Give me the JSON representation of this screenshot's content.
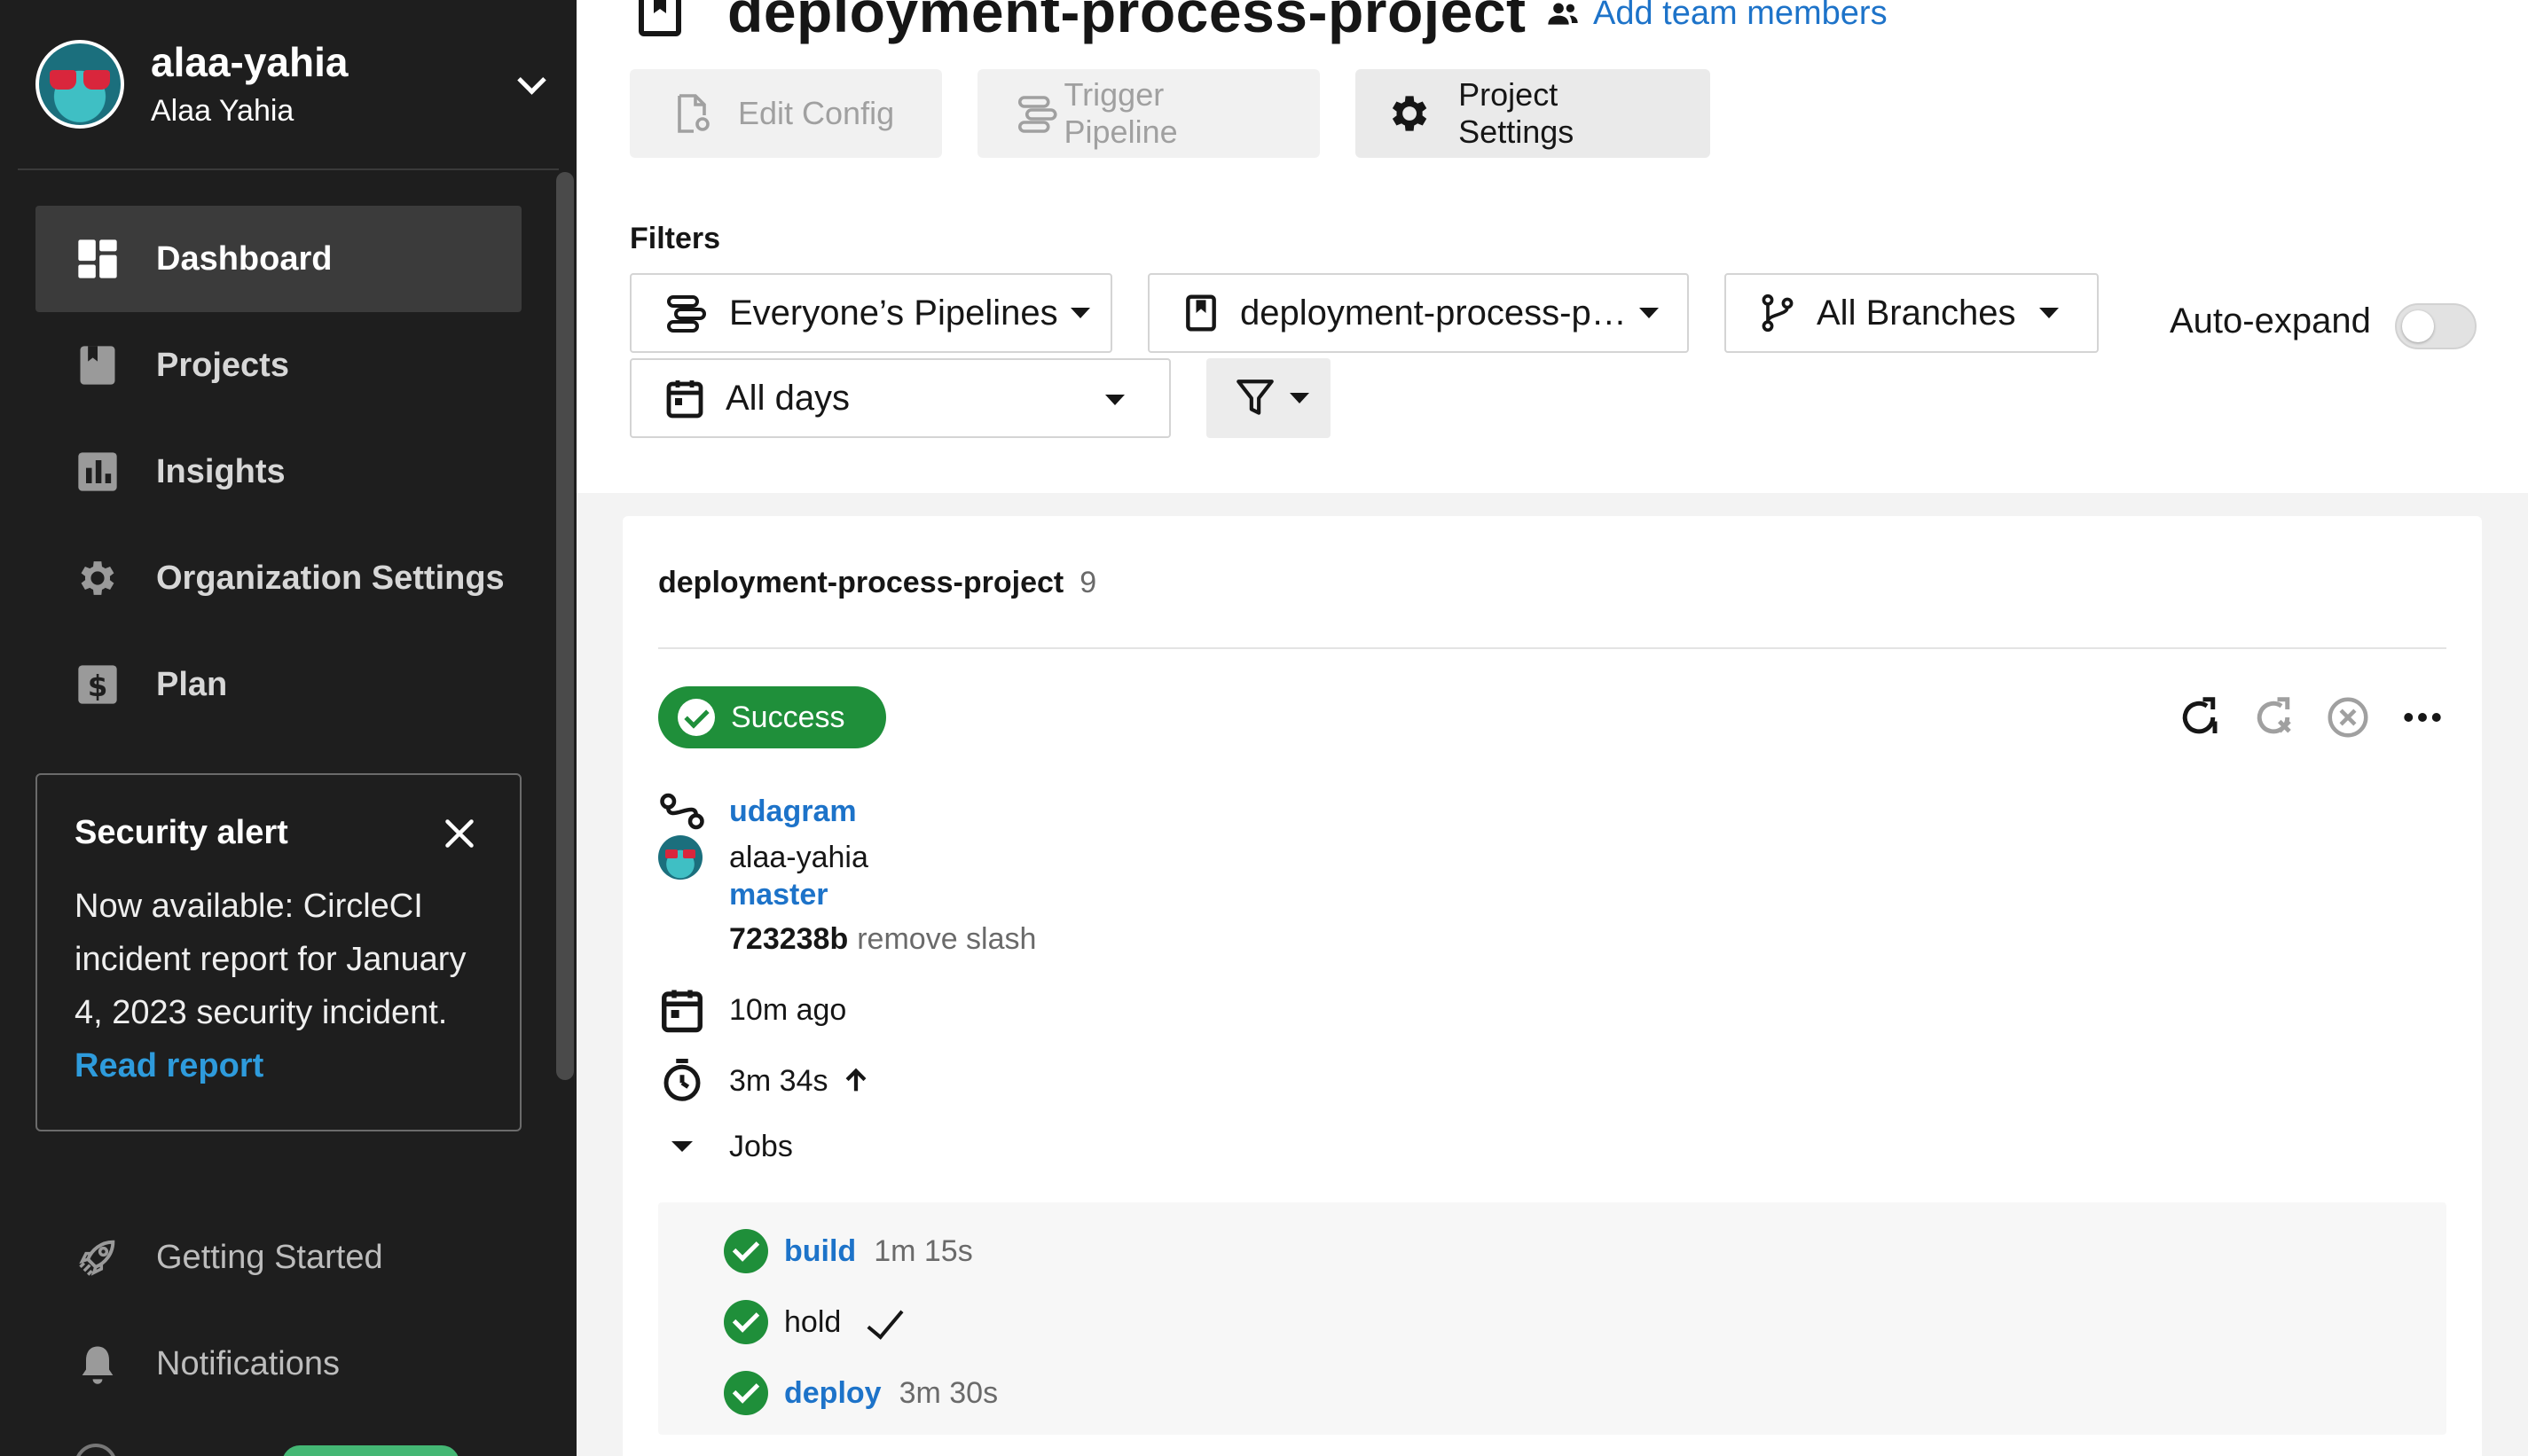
{
  "user": {
    "handle": "alaa-yahia",
    "full_name": "Alaa Yahia"
  },
  "nav": [
    {
      "label": "Dashboard",
      "icon": "dashboard-icon",
      "active": true
    },
    {
      "label": "Projects",
      "icon": "projects-icon"
    },
    {
      "label": "Insights",
      "icon": "insights-icon"
    },
    {
      "label": "Organization Settings",
      "icon": "gear-icon"
    },
    {
      "label": "Plan",
      "icon": "dollar-icon"
    }
  ],
  "security_alert": {
    "title": "Security alert",
    "body": "Now available: CircleCI incident report for January 4, 2023 security incident.",
    "link": "Read report"
  },
  "bottom_nav": [
    {
      "label": "Getting Started",
      "icon": "rocket-icon"
    },
    {
      "label": "Notifications",
      "icon": "bell-icon"
    }
  ],
  "header": {
    "title": "deployment-process-project",
    "add_members": "Add team members"
  },
  "toolbar": {
    "edit_config": "Edit Config",
    "trigger_pipeline": "Trigger Pipeline",
    "project_settings": "Project Settings"
  },
  "filters": {
    "label": "Filters",
    "pipelines": "Everyone’s Pipelines",
    "project": "deployment-process-p…",
    "branches": "All Branches",
    "days": "All days",
    "auto_expand": "Auto-expand"
  },
  "pipeline": {
    "project_name": "deployment-process-project",
    "count": "9",
    "status": "Success",
    "workflow": "udagram",
    "author": "alaa-yahia",
    "branch": "master",
    "commit_sha": "723238b",
    "commit_message": "remove slash",
    "time_ago": "10m ago",
    "duration": "3m 34s",
    "jobs_label": "Jobs",
    "jobs": [
      {
        "name": "build",
        "duration": "1m 15s",
        "is_link": true
      },
      {
        "name": "hold",
        "duration": "",
        "is_link": false
      },
      {
        "name": "deploy",
        "duration": "3m 30s",
        "is_link": true
      }
    ]
  },
  "colors": {
    "sidebar_bg": "#1e1e1e",
    "success": "#1f8f3a",
    "link": "#1d73c9",
    "alert_link": "#2e9bdc"
  }
}
